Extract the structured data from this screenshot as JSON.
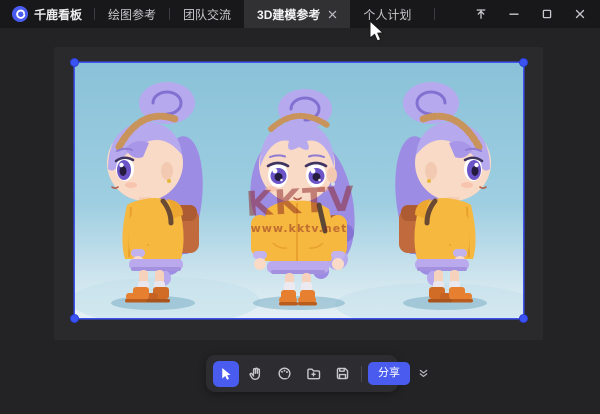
{
  "app": {
    "name": "千鹿看板"
  },
  "tabbar": {
    "logo": {
      "label": "千鹿看板",
      "icon": "swirl-logo-icon",
      "color": "#4a5cf0"
    },
    "tabs": [
      {
        "label": "绘图参考",
        "active": false
      },
      {
        "label": "团队交流",
        "active": false
      },
      {
        "label": "3D建模参考",
        "active": true,
        "closable": true
      },
      {
        "label": "个人计划",
        "active": false
      }
    ],
    "window_controls": [
      "pin-to-top",
      "minimize",
      "maximize",
      "close"
    ]
  },
  "canvas": {
    "image": {
      "description": "3D chibi girl character turnaround: left profile, front, right profile",
      "selected": true,
      "selection_color": "#3e52f2",
      "background_color": "#8fc6db"
    },
    "watermark": {
      "line1": "KKTV",
      "line2": "www.kktv.net"
    }
  },
  "toolbar": {
    "tools": [
      "select",
      "hand",
      "palette",
      "import-file",
      "save"
    ],
    "active_tool": "select",
    "share_label": "分享",
    "accent": "#4a5cf0"
  }
}
